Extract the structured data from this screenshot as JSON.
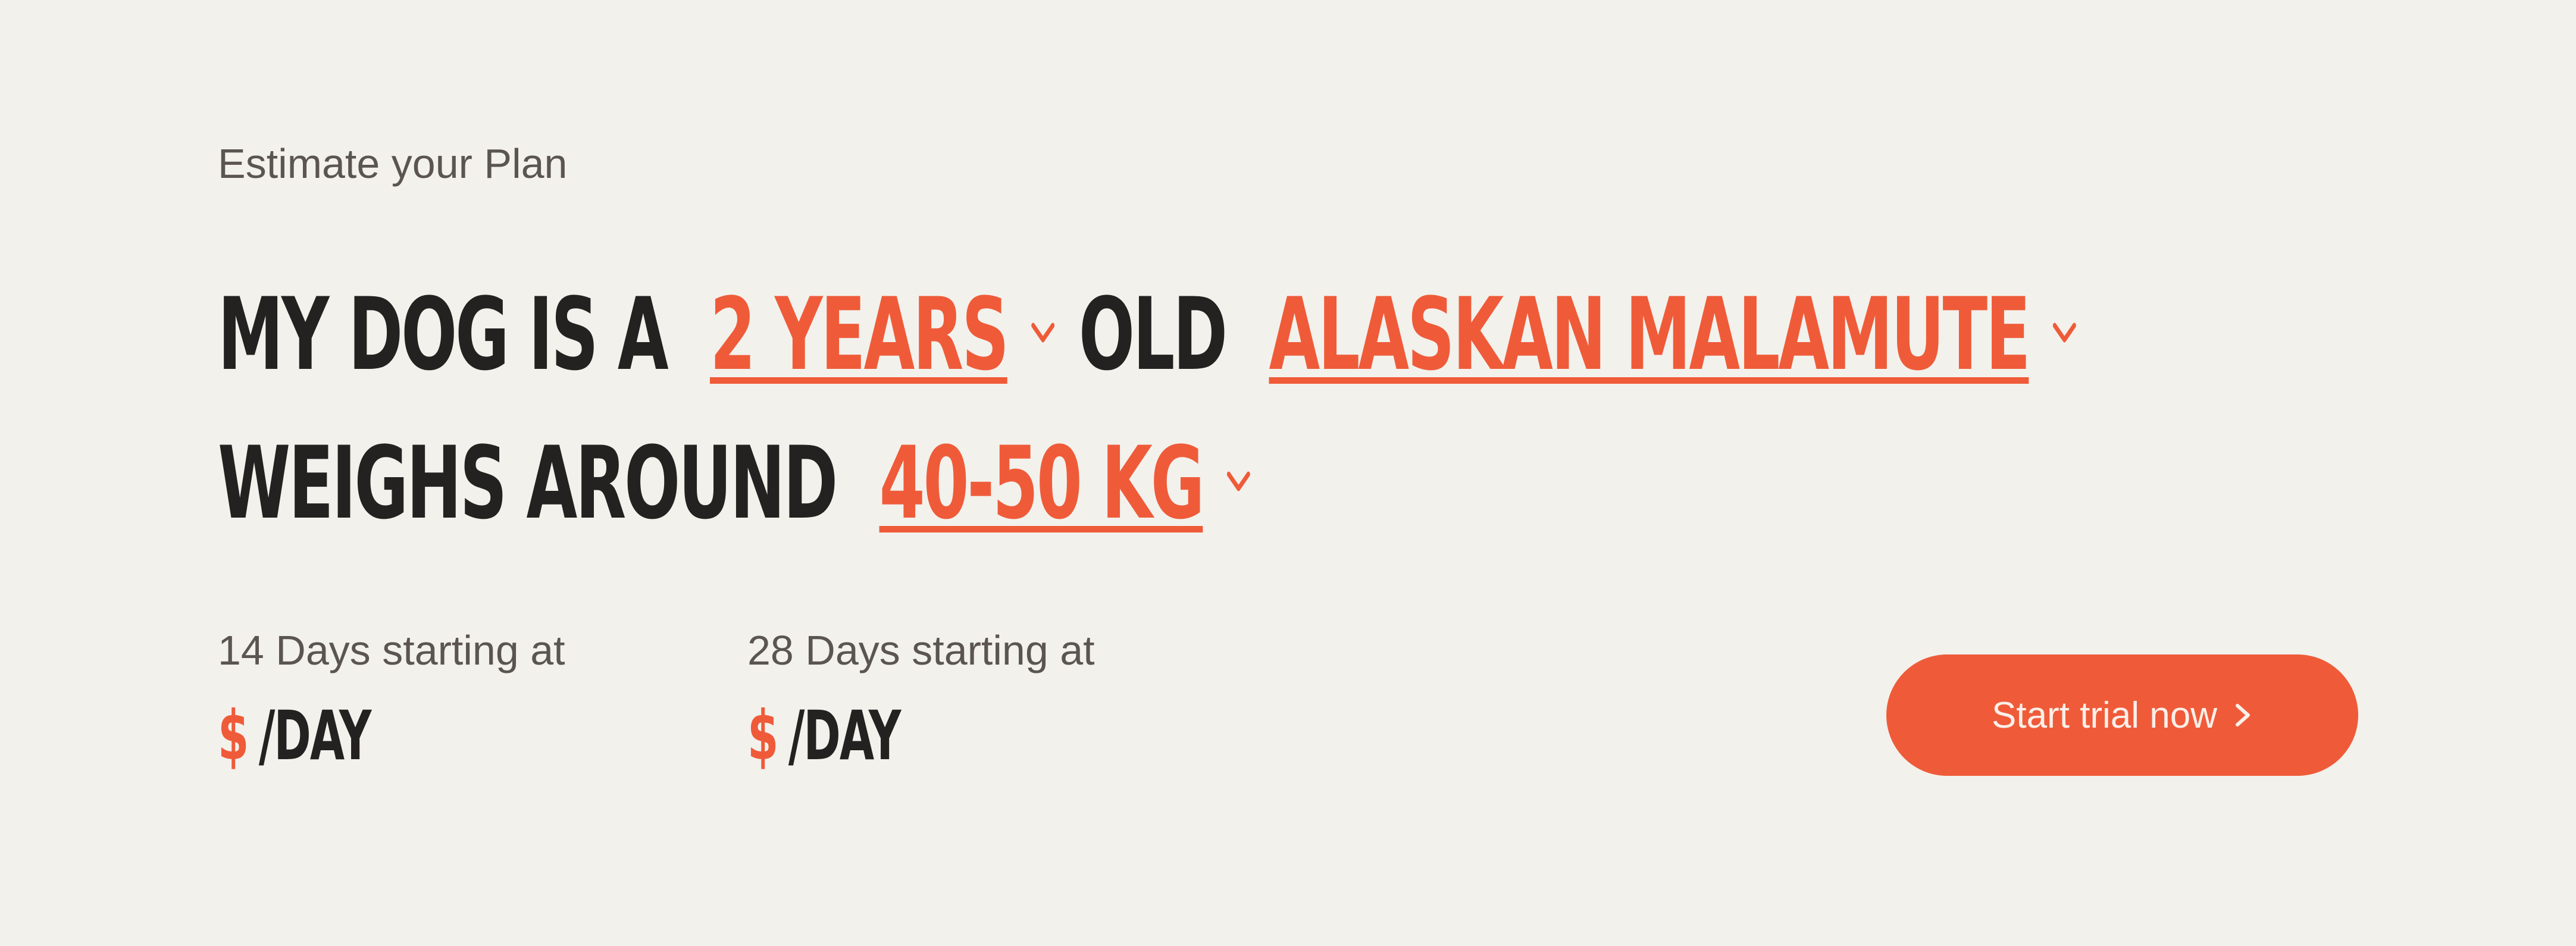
{
  "header": {
    "eyebrow": "Estimate your Plan"
  },
  "sentence": {
    "prefix": "MY DOG IS A",
    "age_value": "2 YEARS",
    "age_suffix": "OLD",
    "breed_value": "ALASKAN MALAMUTE",
    "weight_prefix": "WEIGHS AROUND",
    "weight_value": "40-50 KG"
  },
  "pricing": [
    {
      "label": "14 Days starting at",
      "currency": "$",
      "unit": "/DAY"
    },
    {
      "label": "28 Days starting at",
      "currency": "$",
      "unit": "/DAY"
    }
  ],
  "cta": {
    "label": "Start trial now"
  },
  "icons": {
    "dropdown": "chevron-down-icon",
    "cta": "chevron-right-icon"
  },
  "colors": {
    "background": "#f3f1ec",
    "accent": "#ef5b39",
    "text": "#232220",
    "muted": "#5b5551"
  }
}
